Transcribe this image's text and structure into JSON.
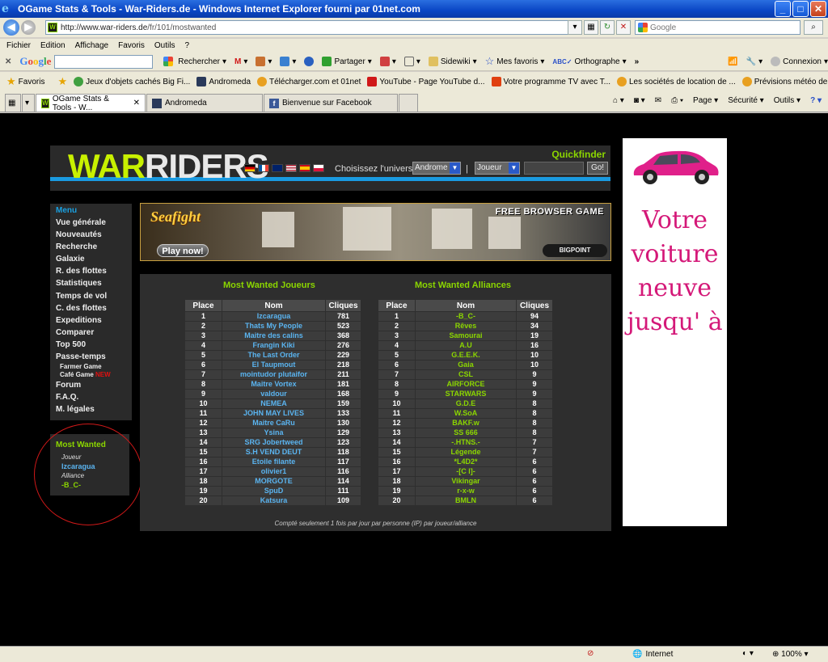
{
  "window": {
    "title": "OGame Stats & Tools - War-Riders.de - Windows Internet Explorer fourni par 01net.com"
  },
  "address": {
    "url_domain": "http://www.war-riders.de",
    "url_path": "/fr/101/mostwanted",
    "search_placeholder": "Google"
  },
  "menubar": [
    "Fichier",
    "Edition",
    "Affichage",
    "Favoris",
    "Outils",
    "?"
  ],
  "google_toolbar": {
    "rechercher": "Rechercher",
    "partager": "Partager",
    "sidewiki": "Sidewiki",
    "mes_favoris": "Mes favoris",
    "orthographe": "Orthographe",
    "connexion": "Connexion"
  },
  "favorites": {
    "label": "Favoris",
    "items": [
      "Jeux d'objets cachés Big Fi...",
      "Andromeda",
      "Télécharger.com et 01net",
      "YouTube - Page YouTube d...",
      "Votre programme TV avec T...",
      "Les sociétés de location de ...",
      "Prévisions météo de Météo-..."
    ]
  },
  "tabs": [
    "OGame Stats & Tools - W...",
    "Andromeda",
    "Bienvenue sur Facebook"
  ],
  "tab_tools": [
    "Page",
    "Sécurité",
    "Outils"
  ],
  "header": {
    "logo_war": "WAR",
    "logo_riders": "RIDERS",
    "choose_universe": "Choisissez l'univers:",
    "universe_value": "Androme",
    "separator": "|",
    "type_value": "Joueur",
    "go_label": "Go!",
    "quickfinder": "Quickfinder"
  },
  "menu": {
    "heading": "Menu",
    "items": [
      "Vue générale",
      "Nouveautés",
      "Recherche",
      "Galaxie",
      "R. des flottes",
      "Statistiques",
      "Temps de vol",
      "C. des flottes",
      "Expeditions",
      "Comparer",
      "Top 500",
      "Passe-temps"
    ],
    "sub_farmer": "Farmer Game",
    "sub_cafe": "Café Game",
    "sub_new": "NEW",
    "items_after": [
      "Forum",
      "F.A.Q.",
      "M. légales"
    ]
  },
  "most_wanted_box": {
    "heading": "Most Wanted",
    "joueur_label": "Joueur",
    "joueur_value": "Izcaragua",
    "alliance_label": "Alliance",
    "alliance_value": "-B_C-"
  },
  "banner": {
    "game": "Seafight",
    "play_now": "Play now!",
    "free_browser_game": "FREE BROWSER GAME",
    "powered": "BIGPOINT"
  },
  "wanted": {
    "players_title": "Most Wanted Joueurs",
    "alliances_title": "Most Wanted Alliances",
    "col_place": "Place",
    "col_name": "Nom",
    "col_clicks": "Cliques",
    "players": [
      [
        "1",
        "Izcaragua",
        "781"
      ],
      [
        "2",
        "Thats My People",
        "523"
      ],
      [
        "3",
        "Maitre des calins",
        "368"
      ],
      [
        "4",
        "Frangin Kiki",
        "276"
      ],
      [
        "5",
        "The Last Order",
        "229"
      ],
      [
        "6",
        "El Taupmout",
        "218"
      ],
      [
        "7",
        "mointudor plutaifor",
        "211"
      ],
      [
        "8",
        "Maitre Vortex",
        "181"
      ],
      [
        "9",
        "valdour",
        "168"
      ],
      [
        "10",
        "NEMEA",
        "159"
      ],
      [
        "11",
        "JOHN MAY LIVES",
        "133"
      ],
      [
        "12",
        "Maitre CaRu",
        "130"
      ],
      [
        "13",
        "Ysina",
        "129"
      ],
      [
        "14",
        "SRG Jobertweed",
        "123"
      ],
      [
        "15",
        "S.H VEND DEUT",
        "118"
      ],
      [
        "16",
        "Etoile filante",
        "117"
      ],
      [
        "17",
        "olivier1",
        "116"
      ],
      [
        "18",
        "MORGOTE",
        "114"
      ],
      [
        "19",
        "SpuD",
        "111"
      ],
      [
        "20",
        "Katsura",
        "109"
      ]
    ],
    "alliances": [
      [
        "1",
        "-B_C-",
        "94"
      ],
      [
        "2",
        "Rêves",
        "34"
      ],
      [
        "3",
        "Samourai",
        "19"
      ],
      [
        "4",
        "A.U",
        "16"
      ],
      [
        "5",
        "G.E.E.K.",
        "10"
      ],
      [
        "6",
        "Gaia",
        "10"
      ],
      [
        "7",
        "CSL",
        "9"
      ],
      [
        "8",
        "AIRFORCE",
        "9"
      ],
      [
        "9",
        "STARWARS",
        "9"
      ],
      [
        "10",
        "G.D.E",
        "8"
      ],
      [
        "11",
        "W.SoA",
        "8"
      ],
      [
        "12",
        "BAKF.w",
        "8"
      ],
      [
        "13",
        "SS 666",
        "8"
      ],
      [
        "14",
        "-.HTNS.-",
        "7"
      ],
      [
        "15",
        "Légende",
        "7"
      ],
      [
        "16",
        "*L4D2*",
        "6"
      ],
      [
        "17",
        "-[C I]-",
        "6"
      ],
      [
        "18",
        "Vikingar",
        "6"
      ],
      [
        "19",
        "r-x-w",
        "6"
      ],
      [
        "20",
        "BMLN",
        "6"
      ]
    ],
    "footnote": "Compté seulement 1 fois par jour par personne (IP) par joueur/alliance"
  },
  "ad": {
    "lines": [
      "Votre",
      "voiture",
      "neuve",
      "jusqu' à"
    ]
  },
  "status": {
    "zone": "Internet",
    "zoom": "100%"
  },
  "colors": {
    "accent_green": "#8bd600",
    "link_blue": "#5ab4f0",
    "menu_blue": "#1aa0e0",
    "ad_pink": "#d41878"
  }
}
